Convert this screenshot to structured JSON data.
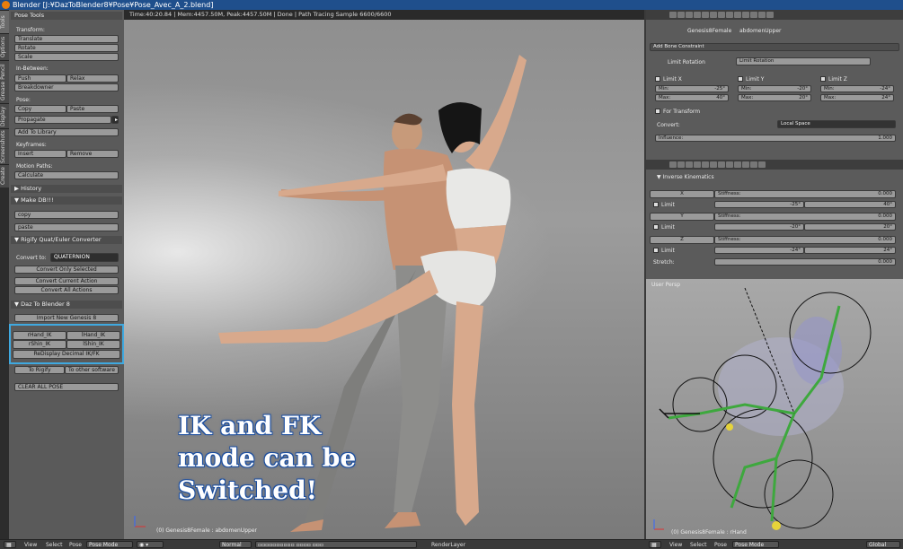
{
  "window": {
    "title": "Blender [J:¥DazToBlender8¥Pose¥Pose_Avec_A_2.blend]"
  },
  "vtabs": [
    "Tools",
    "Options",
    "Grease Pencil",
    "Display",
    "Screenshots",
    "Create"
  ],
  "tool_panel": {
    "pose_tools": "Pose Tools",
    "transform_label": "Transform:",
    "translate": "Translate",
    "rotate": "Rotate",
    "scale": "Scale",
    "inbetween_label": "In-Between:",
    "push": "Push",
    "relax": "Relax",
    "breakdowner": "Breakdowner",
    "pose_label": "Pose:",
    "copy": "Copy",
    "paste": "Paste",
    "propagate": "Propagate",
    "add_to_library": "Add To Library",
    "keyframes_label": "Keyframes:",
    "insert": "Insert",
    "remove": "Remove",
    "motion_paths_label": "Motion Paths:",
    "calculate": "Calculate",
    "history": "History",
    "make_db": "Make DB!!!",
    "copy_lc": "copy",
    "paste_lc": "paste",
    "rigify": "Rigify Quat/Euler Converter",
    "convert_to_label": "Convert to:",
    "convert_to_value": "QUATERNION",
    "convert_only_selected": "Convert Only Selected",
    "convert_current_action": "Convert Current Action",
    "convert_all_actions": "Convert All Actions",
    "daz_to_blender": "Daz To Blender 8",
    "import_new": "Import New Genesis 8",
    "rhand_ik": "rHand_IK",
    "lhand_ik": "lHand_IK",
    "rshin_ik": "rShin_IK",
    "lshin_ik": "lShin_IK",
    "redisplay": "ReDisplay Decimal IK/FK",
    "to_rigify": "To Rigify",
    "to_other": "To other software",
    "clear_all_pose": "CLEAR ALL POSE"
  },
  "viewport": {
    "header": "Time:40:20.84 | Mem:4457.50M, Peak:4457.50M | Done | Path Tracing Sample 6600/6600",
    "overlay": [
      "IK and FK",
      "mode can be",
      "Switched!"
    ],
    "footer": "(0) Genesis8Female : abdomenUpper"
  },
  "bone_constraints": {
    "breadcrumb_object": "Genesis8Female",
    "breadcrumb_bone": "abdomenUpper",
    "add_constraint": "Add Bone Constraint",
    "constraint_type": "Limit Rotation",
    "constraint_name": "Limit Rotation",
    "limit_x": "Limit X",
    "limit_y": "Limit Y",
    "limit_z": "Limit Z",
    "min_label": "Min:",
    "max_label": "Max:",
    "x_min": "-25°",
    "x_max": "40°",
    "y_min": "-20°",
    "y_max": "20°",
    "z_min": "-24°",
    "z_max": "24°",
    "for_transform": "For Transform",
    "convert_label": "Convert:",
    "convert_value": "Local Space",
    "influence_label": "Influence:",
    "influence_value": "1.000"
  },
  "ik_panel": {
    "title": "Inverse Kinematics",
    "x": "X",
    "y": "Y",
    "z": "Z",
    "stiffness_label": "Stiffness:",
    "stiffness_value": "0.000",
    "limit_label": "Limit",
    "x_min": "-25°",
    "x_max": "40°",
    "y_min": "-20°",
    "y_max": "20°",
    "z_min": "-24°",
    "z_max": "24°",
    "stretch_label": "Stretch:",
    "stretch_value": "0.000"
  },
  "sub_viewport": {
    "header": "User Persp",
    "footer": "(0) Genesis8Female : rHand"
  },
  "bottom_bar": {
    "view": "View",
    "select": "Select",
    "pose": "Pose",
    "mode": "Pose Mode",
    "normal": "Normal",
    "render_layer": "RenderLayer",
    "view2": "View",
    "select2": "Select",
    "pose2": "Pose",
    "mode2": "Pose Mode",
    "global": "Global"
  },
  "colors": {
    "highlight": "#3fa9e0",
    "title_bar": "#1f4f8c",
    "ik_text_outline": "#1d4fa0"
  }
}
